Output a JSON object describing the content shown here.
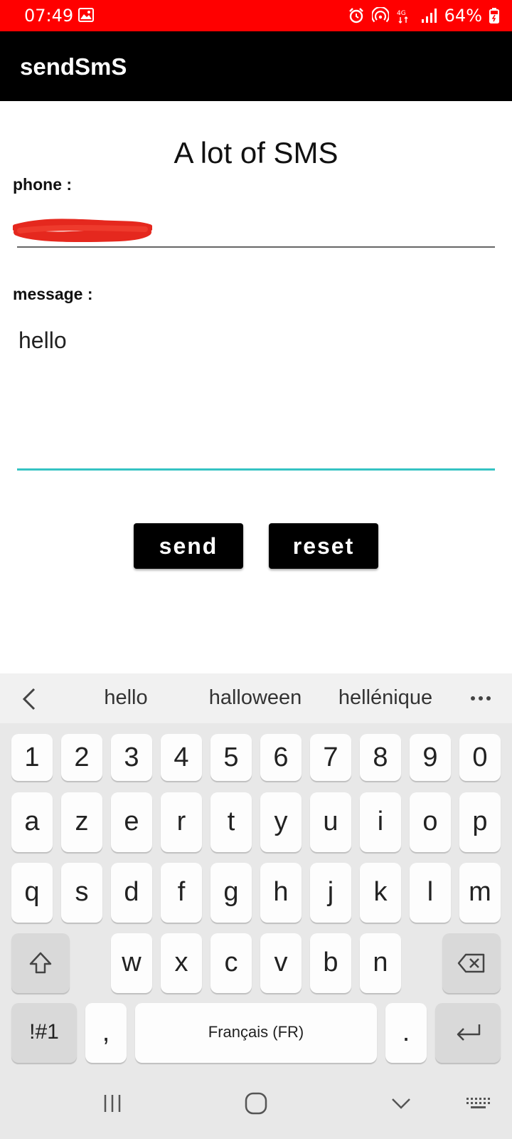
{
  "status_bar": {
    "time": "07:49",
    "battery_text": "64%",
    "network_type": "4G",
    "background_color": "#ff0000",
    "icons": [
      "gallery-icon",
      "alarm-icon",
      "hotspot-icon",
      "network-4g-icon",
      "signal-icon",
      "battery-charging-icon"
    ]
  },
  "app_bar": {
    "title": "sendSmS",
    "background_color": "#000000"
  },
  "form": {
    "heading": "A lot of SMS",
    "phone_label": "phone :",
    "phone_value": "",
    "phone_redacted": true,
    "message_label": "message :",
    "message_value": "hello",
    "focus_color": "#35c3c3",
    "send_label": "send",
    "reset_label": "reset"
  },
  "keyboard": {
    "suggestions": [
      "hello",
      "halloween",
      "hellénique"
    ],
    "number_row": [
      "1",
      "2",
      "3",
      "4",
      "5",
      "6",
      "7",
      "8",
      "9",
      "0"
    ],
    "row1": [
      "a",
      "z",
      "e",
      "r",
      "t",
      "y",
      "u",
      "i",
      "o",
      "p"
    ],
    "row2": [
      "q",
      "s",
      "d",
      "f",
      "g",
      "h",
      "j",
      "k",
      "l",
      "m"
    ],
    "row3": [
      "w",
      "x",
      "c",
      "v",
      "b",
      "n"
    ],
    "symbols_label": "!#1",
    "comma_label": ",",
    "space_label": "Français (FR)",
    "period_label": "."
  },
  "nav_bar": {
    "icons": [
      "recent-apps-icon",
      "home-icon",
      "back-icon",
      "keyboard-switch-icon"
    ]
  }
}
